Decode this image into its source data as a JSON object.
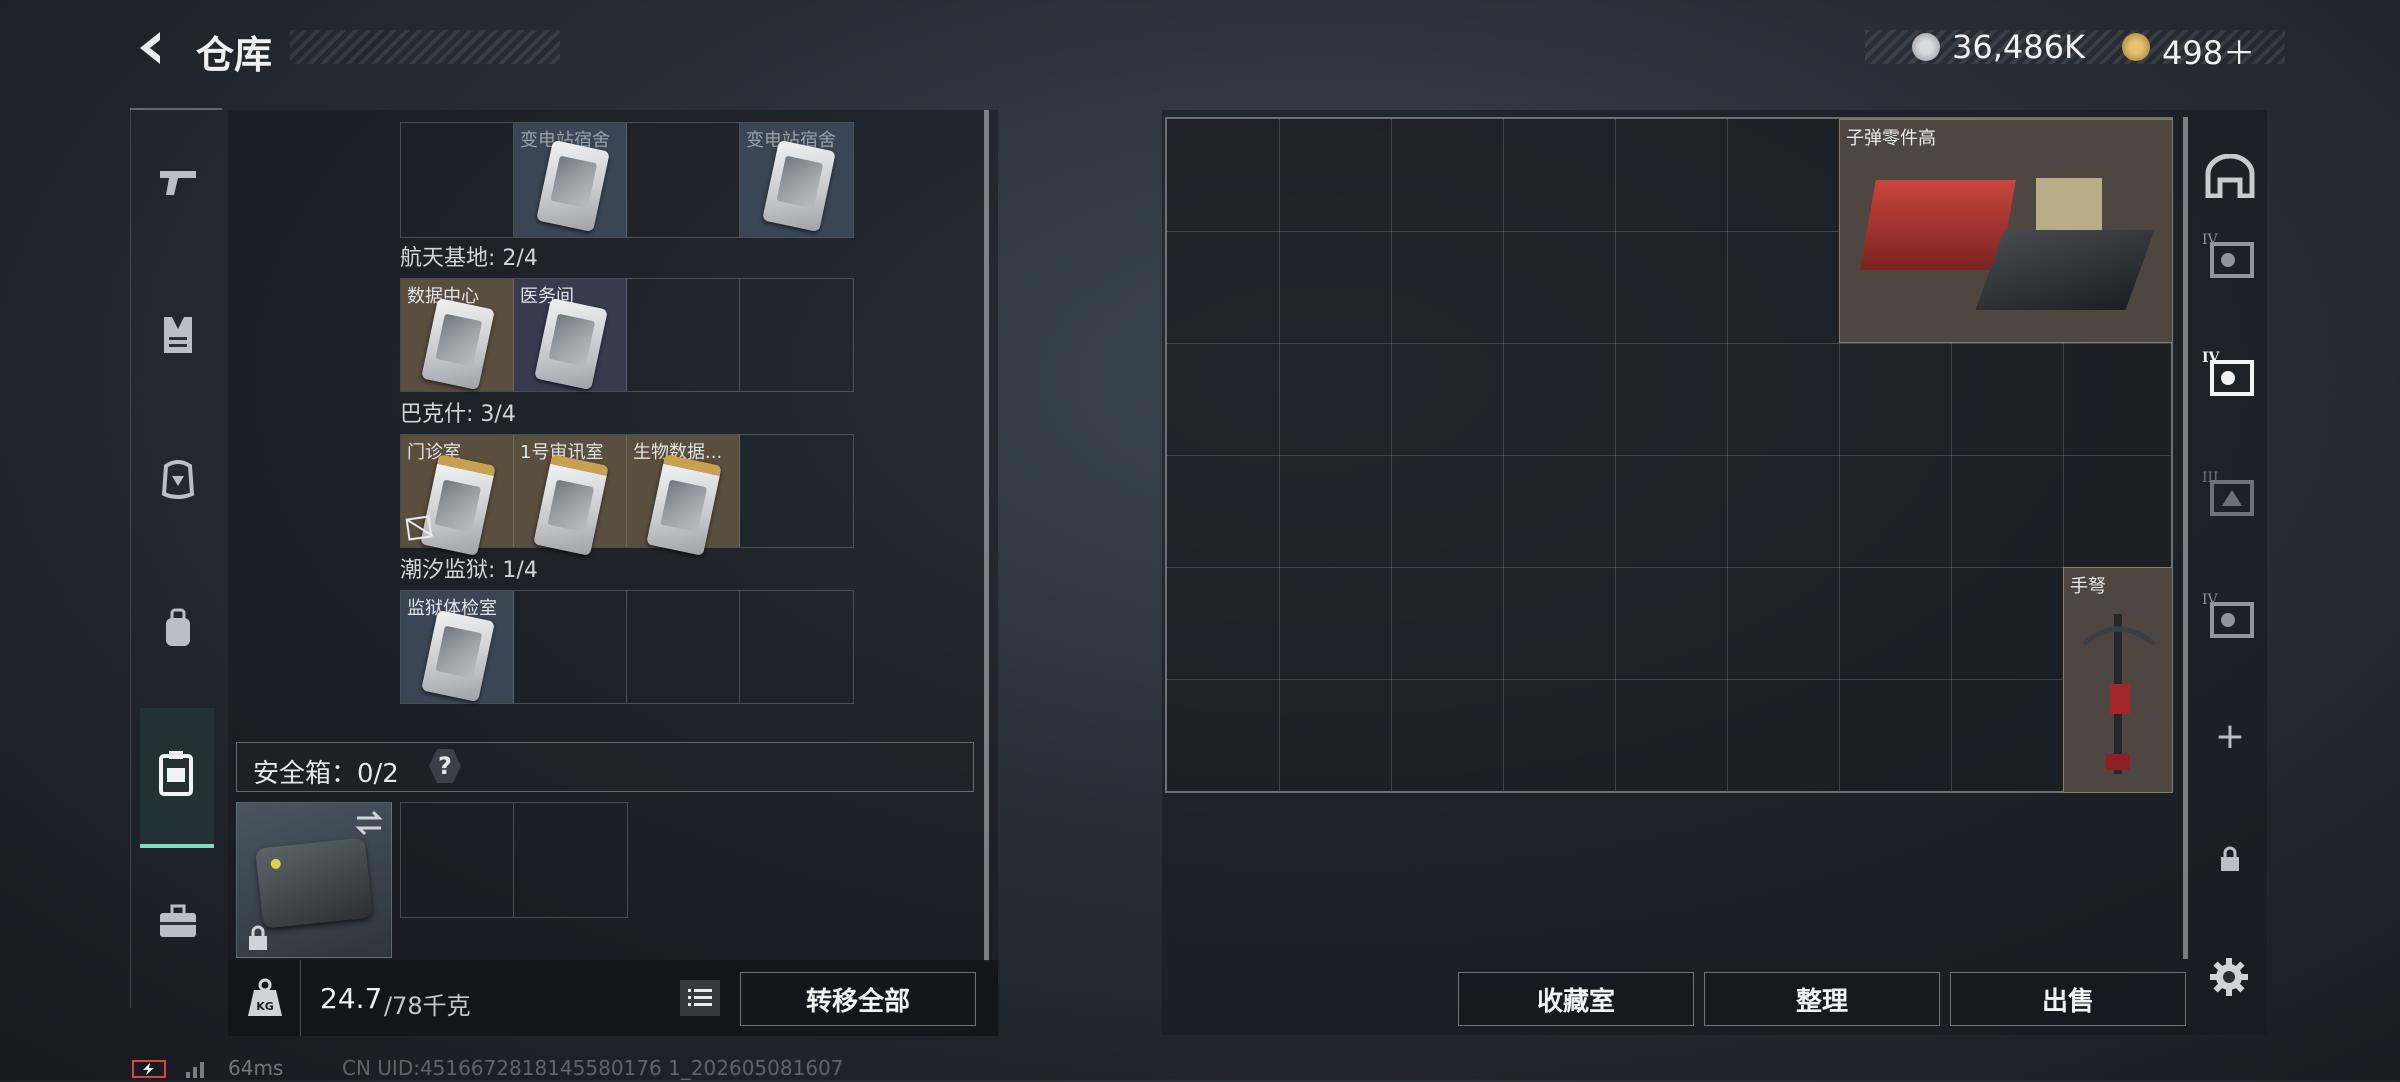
{
  "header": {
    "back_icon": "back-arrow-icon",
    "title": "仓库",
    "currency1": {
      "icon": "coin-icon",
      "value": "36,486K"
    },
    "currency2": {
      "icon": "triangle-coin-icon",
      "value": "498＋"
    }
  },
  "left_nav": [
    {
      "icon": "pistol-icon"
    },
    {
      "icon": "vest-icon"
    },
    {
      "icon": "helmet-icon"
    },
    {
      "icon": "backpack-icon"
    },
    {
      "icon": "container-icon",
      "active": true
    },
    {
      "icon": "toolbox-icon"
    }
  ],
  "keycards": {
    "top_row": [
      "",
      "变电站宿舍",
      "",
      "变电站宿舍"
    ],
    "regions": [
      {
        "name": "航天基地: 2/4",
        "slots": [
          "数据中心",
          "医务间",
          "",
          ""
        ]
      },
      {
        "name": "巴克什: 3/4",
        "slots": [
          "门诊室",
          "1号审讯室",
          "生物数据...",
          ""
        ]
      },
      {
        "name": "潮汐监狱: 1/4",
        "slots": [
          "监狱体检室",
          "",
          "",
          ""
        ]
      }
    ]
  },
  "safe_box": {
    "label": "安全箱：0/2",
    "help": "?",
    "swap_icon": "swap-arrows-icon",
    "lock_icon": "lock-icon"
  },
  "weight": {
    "icon": "weight-kg-icon",
    "current": "24.7",
    "max": "/78千克"
  },
  "bottom_left": {
    "list_icon": "list-icon",
    "transfer_all": "转移全部"
  },
  "storage_items": [
    {
      "label": "子弹零件高"
    },
    {
      "label": "手弩"
    }
  ],
  "right_nav": [
    {
      "icon": "arch-icon",
      "text": ""
    },
    {
      "icon": "storage-iv-icon",
      "text": "IV"
    },
    {
      "icon": "storage-iv-active-icon",
      "text": "IV"
    },
    {
      "icon": "storage-iii-icon",
      "text": "III"
    },
    {
      "icon": "storage-iv-2-icon",
      "text": "IV"
    },
    {
      "icon": "plus-icon",
      "text": "+"
    },
    {
      "icon": "lock-icon",
      "text": ""
    }
  ],
  "bottom_right": {
    "collection": "收藏室",
    "organize": "整理",
    "sell": "出售",
    "settings_icon": "gear-icon"
  },
  "footer": {
    "ping": "64ms",
    "uid": "CN UID:4516672818145580176 1_202605081607"
  }
}
